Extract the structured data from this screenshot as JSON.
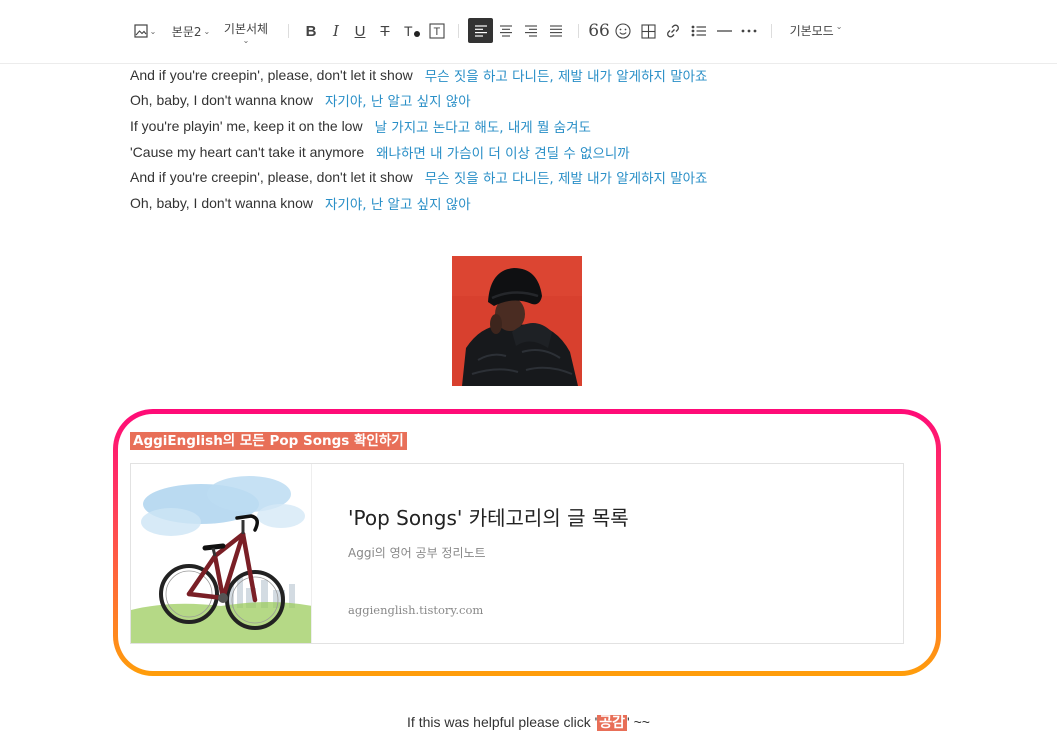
{
  "toolbar": {
    "paragraph_style": "본문2",
    "font_family": "기본서체",
    "mode": "기본모드"
  },
  "lyrics": [
    {
      "en": "And if you're creepin', please, don't let it show",
      "ko": "무슨 짓을 하고 다니든, 제발 내가 알게하지 말아죠"
    },
    {
      "en": "Oh, baby, I don't wanna know",
      "ko": "자기야, 난 알고 싶지 않아"
    },
    {
      "en": "If you're playin' me, keep it on the low",
      "ko": "날 가지고 논다고 해도, 내게 뭘 숨겨도"
    },
    {
      "en": "'Cause my heart can't take it anymore",
      "ko": "왜냐하면 내 가슴이 더 이상 견딜 수 없으니까"
    },
    {
      "en": "And if you're creepin', please, don't let it show",
      "ko": "무슨 짓을 하고 다니든, 제발 내가 알게하지 말아죠"
    },
    {
      "en": "Oh, baby, I don't wanna know",
      "ko": "자기야, 난 알고 싶지 않아"
    }
  ],
  "promo": {
    "heading": "AggiEnglish의 모든 Pop Songs 확인하기",
    "card": {
      "title": "'Pop Songs' 카테고리의 글 목록",
      "description": "Aggi의 영어 공부 정리노트",
      "url": "aggienglish.tistory.com"
    }
  },
  "footer": {
    "prefix": "If this was helpful please click '",
    "highlight": "공감",
    "suffix": "' ~~"
  },
  "colors": {
    "lyric_translation": "#2a8fc7",
    "highlight": "#e86f58",
    "gradient_top": "#ff0a78",
    "gradient_bottom": "#ff9e0a"
  }
}
